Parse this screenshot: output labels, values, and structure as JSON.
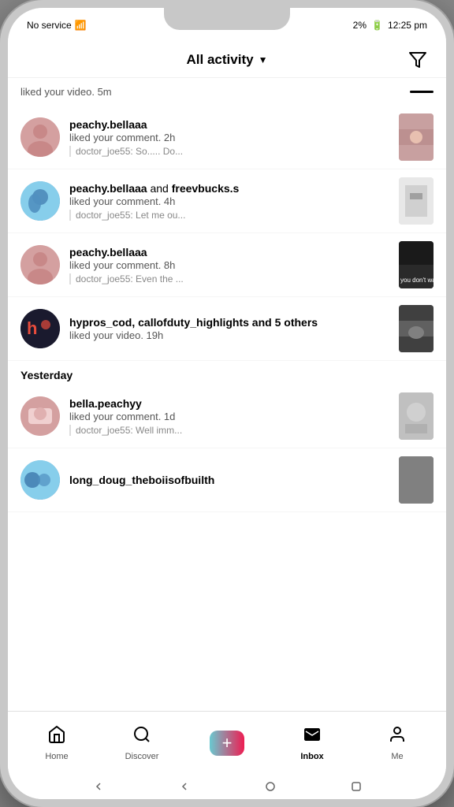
{
  "statusBar": {
    "carrier": "No service",
    "battery": "2%",
    "time": "12:25 pm"
  },
  "header": {
    "title": "All activity",
    "filterIcon": "▽"
  },
  "firstItem": {
    "action": "liked your video.",
    "time": "5m"
  },
  "notifications": [
    {
      "id": 1,
      "username": "peachy.bellaaa",
      "action": "liked your comment. 2h",
      "comment": "doctor_joe55: So..... Do...",
      "avatarClass": "av-peachy",
      "thumbClass": "thumb-1"
    },
    {
      "id": 2,
      "username": "peachy.bellaaa",
      "usernameExtra": "and freevbucks.s",
      "action": "liked your comment. 4h",
      "comment": "doctor_joe55: Let me ou...",
      "avatarClass": "av-peachy2",
      "thumbClass": "thumb-2"
    },
    {
      "id": 3,
      "username": "peachy.bellaaa",
      "action": "liked your comment. 8h",
      "comment": "doctor_joe55: Even the ...",
      "avatarClass": "av-peachy",
      "thumbClass": "thumb-3"
    },
    {
      "id": 4,
      "username": "hypros_cod,",
      "usernameBold": "callofduty_highlights",
      "usernameExtra": "and 5 others",
      "action": "liked your video. 19h",
      "comment": "",
      "avatarClass": "av-hypros",
      "thumbClass": "thumb-4"
    }
  ],
  "yesterday": {
    "label": "Yesterday",
    "items": [
      {
        "id": 5,
        "username": "bella.peachyy",
        "action": "liked your comment. 1d",
        "comment": "doctor_joe55: Well imm...",
        "avatarClass": "av-bella",
        "thumbClass": "thumb-5"
      },
      {
        "id": 6,
        "username": "long_doug_theboiisofbuilth",
        "action": "",
        "comment": "",
        "avatarClass": "av-long",
        "thumbClass": "thumb-4"
      }
    ]
  },
  "bottomNav": {
    "items": [
      {
        "id": "home",
        "label": "Home",
        "icon": "⌂",
        "active": false
      },
      {
        "id": "discover",
        "label": "Discover",
        "icon": "○",
        "active": false
      },
      {
        "id": "inbox",
        "label": "Inbox",
        "icon": "◼",
        "active": true
      },
      {
        "id": "me",
        "label": "Me",
        "icon": "◯",
        "active": false
      }
    ],
    "createLabel": "+"
  }
}
